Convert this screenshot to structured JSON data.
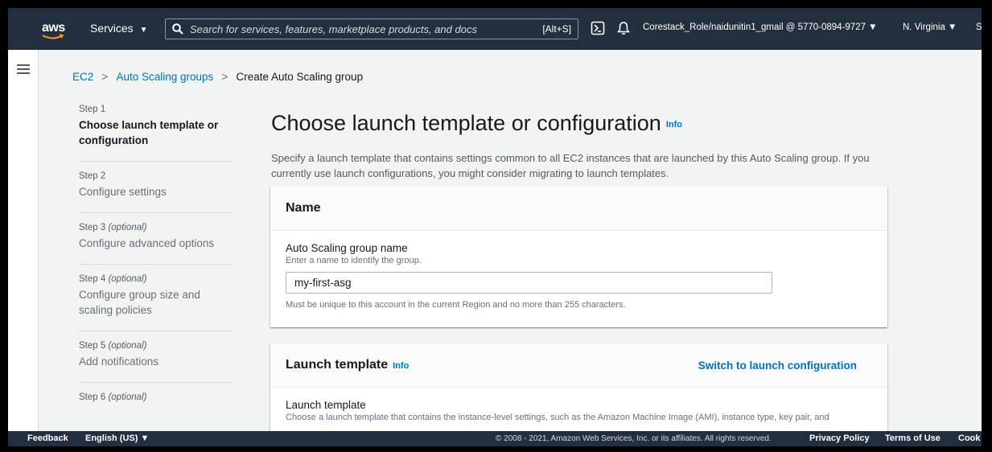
{
  "nav": {
    "logo": "aws",
    "services_label": "Services",
    "services_caret": "▼",
    "search_placeholder": "Search for services, features, marketplace products, and docs",
    "search_shortcut": "[Alt+S]",
    "account": "Corestack_Role/naidunitin1_gmail @ 5770-0894-9727 ▼",
    "region": "N. Virginia ▼",
    "support_truncated": "S"
  },
  "breadcrumb": {
    "items": [
      "EC2",
      "Auto Scaling groups"
    ],
    "separator": ">",
    "current": "Create Auto Scaling group"
  },
  "steps": [
    {
      "number": "Step 1",
      "optional": "",
      "title": "Choose launch template or configuration"
    },
    {
      "number": "Step 2",
      "optional": "",
      "title": "Configure settings"
    },
    {
      "number": "Step 3",
      "optional": "(optional)",
      "title": "Configure advanced options"
    },
    {
      "number": "Step 4",
      "optional": "(optional)",
      "title": "Configure group size and scaling policies"
    },
    {
      "number": "Step 5",
      "optional": "(optional)",
      "title": "Add notifications"
    },
    {
      "number": "Step 6",
      "optional": "(optional)",
      "title": ""
    }
  ],
  "page": {
    "title": "Choose launch template or configuration",
    "info": "Info",
    "description": "Specify a launch template that contains settings common to all EC2 instances that are launched by this Auto Scaling group. If you currently use launch configurations, you might consider migrating to launch templates."
  },
  "name_panel": {
    "header": "Name",
    "field_label": "Auto Scaling group name",
    "field_desc": "Enter a name to identify the group.",
    "value": "my-first-asg",
    "constraint": "Must be unique to this account in the current Region and no more than 255 characters."
  },
  "launch_panel": {
    "header": "Launch template",
    "info": "Info",
    "switch_link": "Switch to launch configuration",
    "field_label": "Launch template",
    "field_desc": "Choose a launch template that contains the instance-level settings, such as the Amazon Machine Image (AMI), instance type, key pair, and"
  },
  "footer": {
    "feedback": "Feedback",
    "language": "English (US) ▼",
    "copyright": "© 2008 - 2021, Amazon Web Services, Inc. or its affiliates. All rights reserved.",
    "privacy": "Privacy Policy",
    "terms": "Terms of Use",
    "cookie": "Cook"
  },
  "colors": {
    "nav_bg": "#232f3e",
    "link": "#0073bb",
    "page_bg": "#f2f3f3"
  },
  "icons": [
    "aws-logo",
    "search-icon",
    "cloudshell-icon",
    "bell-icon",
    "hamburger-icon"
  ]
}
